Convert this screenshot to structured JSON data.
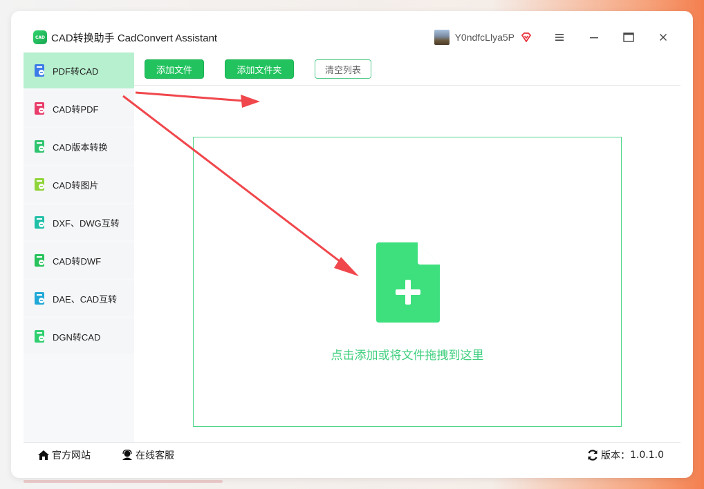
{
  "app": {
    "logo_text": "CAD",
    "title": "CAD转换助手 CadConvert Assistant",
    "username": "Y0ndfcLlya5P"
  },
  "sidebar": {
    "items": [
      {
        "label": "PDF转CAD",
        "icon": "pdf-to-cad-icon",
        "active": true
      },
      {
        "label": "CAD转PDF",
        "icon": "cad-to-pdf-icon"
      },
      {
        "label": "CAD版本转换",
        "icon": "cad-version-icon"
      },
      {
        "label": "CAD转图片",
        "icon": "cad-to-image-icon"
      },
      {
        "label": "DXF、DWG互转",
        "icon": "dxf-dwg-icon"
      },
      {
        "label": "CAD转DWF",
        "icon": "cad-to-dwf-icon"
      },
      {
        "label": "DAE、CAD互转",
        "icon": "dae-cad-icon"
      },
      {
        "label": "DGN转CAD",
        "icon": "dgn-to-cad-icon"
      }
    ]
  },
  "toolbar": {
    "add_file": "添加文件",
    "add_folder": "添加文件夹",
    "clear_list": "清空列表"
  },
  "dropzone": {
    "text": "点击添加或将文件拖拽到这里"
  },
  "footer": {
    "website": "官方网站",
    "support": "在线客服",
    "version_label": "版本：",
    "version": "1.0.1.0"
  },
  "colors": {
    "accent": "#22c35e",
    "active_nav": "#b7f0cf",
    "arrow": "#f0474c"
  }
}
